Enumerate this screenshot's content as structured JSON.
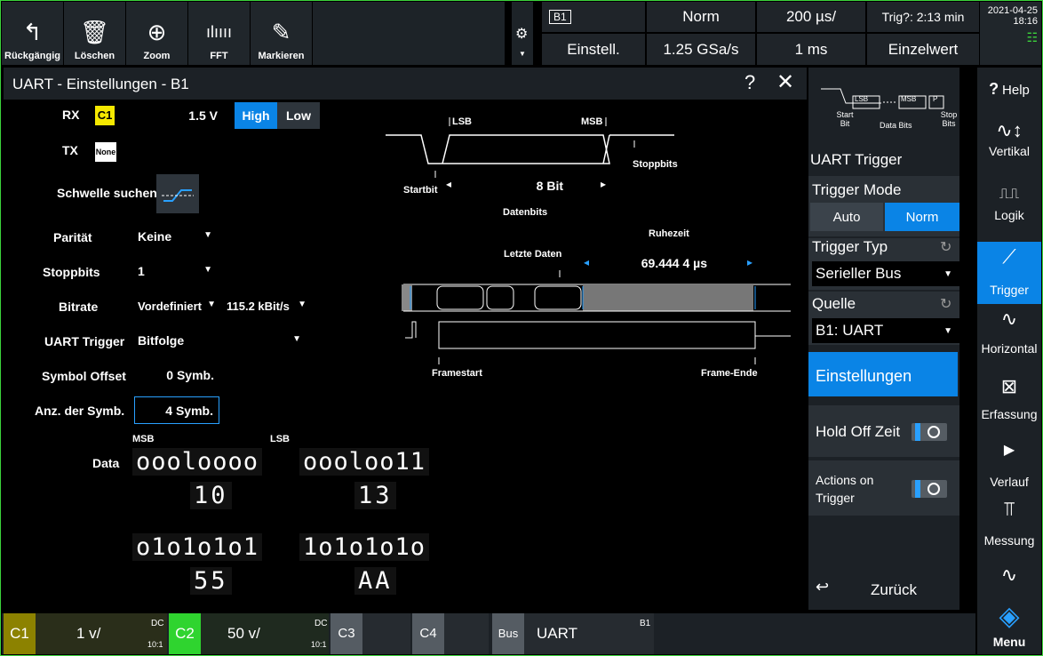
{
  "toolbar": {
    "undo": "Rückgängig",
    "delete": "Löschen",
    "zoom": "Zoom",
    "fft": "FFT",
    "mark": "Markieren"
  },
  "status": {
    "bus_label": "B1",
    "setup": "Einstell.",
    "trigger_mode": "Norm",
    "sample_rate": "1.25 GSa/s",
    "timebase": "200 µs/",
    "record": "1 ms",
    "trig_time": "Trig?: 2:13 min",
    "acq_mode": "Einzelwert",
    "date": "2021-04-25",
    "time": "18:16"
  },
  "dialog": {
    "title": "UART - Einstellungen - B1",
    "help": "?",
    "rx_label": "RX",
    "rx_source": "C1",
    "rx_threshold": "1.5 V",
    "high": "High",
    "low": "Low",
    "tx_label": "TX",
    "tx_source": "None",
    "find_threshold": "Schwelle suchen",
    "parity_label": "Parität",
    "parity_value": "Keine",
    "stopbits_label": "Stoppbits",
    "stopbits_value": "1",
    "bitrate_label": "Bitrate",
    "bitrate_mode": "Vordefiniert",
    "bitrate_value": "115.2 kBit/s",
    "uart_trigger_label": "UART Trigger",
    "uart_trigger_value": "Bitfolge",
    "symbol_offset_label": "Symbol Offset",
    "symbol_offset_value": "0 Symb.",
    "num_symbols_label": "Anz. der Symb.",
    "num_symbols_value": "4 Symb.",
    "msb": "MSB",
    "lsb": "LSB",
    "data_label": "Data",
    "data": [
      {
        "bits": "oooloooo",
        "hex": "10"
      },
      {
        "bits": "oooloo11",
        "hex": "13"
      },
      {
        "bits": "o1o1o1o1",
        "hex": "55"
      },
      {
        "bits": "1o1o1o1o",
        "hex": "AA"
      }
    ]
  },
  "diagram": {
    "lsb": "LSB",
    "msb": "MSB",
    "stopbits": "Stoppbits",
    "startbit": "Startbit",
    "databits_value": "8 Bit",
    "databits": "Datenbits",
    "idle_time": "Ruhezeit",
    "last_data": "Letzte Daten",
    "idle_value": "69.444 4 µs",
    "frame_start": "Framestart",
    "frame_end": "Frame-Ende"
  },
  "trigger_panel": {
    "icon_start": "Start Bit",
    "icon_data": "Data Bits",
    "icon_stop": "Stop Bits",
    "icon_lsb": "LSB",
    "icon_msb": "MSB",
    "icon_p": "P",
    "title": "UART Trigger",
    "mode_label": "Trigger Mode",
    "mode_auto": "Auto",
    "mode_norm": "Norm",
    "type_label": "Trigger Typ",
    "type_value": "Serieller Bus",
    "source_label": "Quelle",
    "source_value": "B1: UART",
    "settings": "Einstellungen",
    "holdoff": "Hold Off Zeit",
    "actions": "Actions on Trigger",
    "back": "Zurück"
  },
  "sidebar": {
    "help": "Help",
    "vertical": "Vertikal",
    "logic": "Logik",
    "trigger": "Trigger",
    "horizontal": "Horizontal",
    "acquisition": "Erfassung",
    "history": "Verlauf",
    "measure": "Messung",
    "menu": "Menu"
  },
  "channels": {
    "c1": "C1",
    "c1_scale": "1 v/",
    "c1_dc": "DC",
    "c1_ratio": "10:1",
    "c2": "C2",
    "c2_scale": "50 v/",
    "c2_dc": "DC",
    "c2_ratio": "10:1",
    "c3": "C3",
    "c4": "C4",
    "bus": "Bus",
    "bus_value": "UART",
    "bus_id": "B1"
  },
  "colors": {
    "accent": "#0a84e6",
    "c1": "#f5e800",
    "c2": "#2fd42f",
    "frame": "#3cd33c"
  }
}
